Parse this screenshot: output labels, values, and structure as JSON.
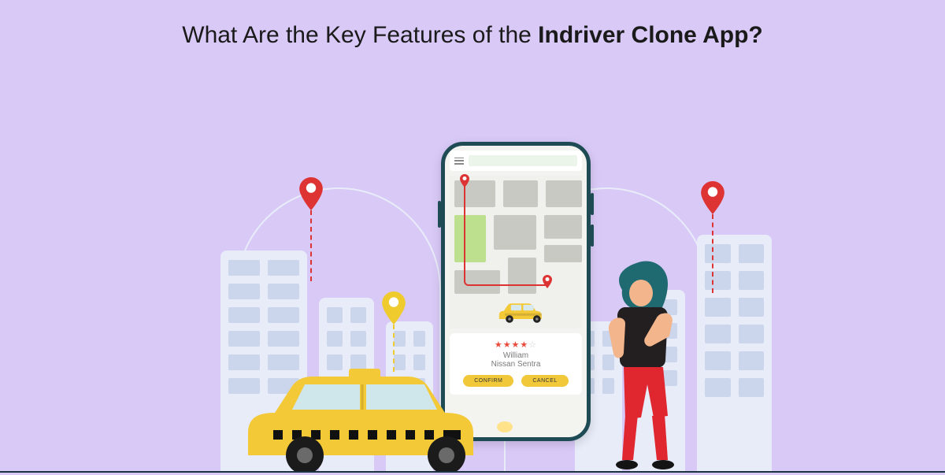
{
  "title_prefix": "What Are the Key Features of the ",
  "title_bold": "Indriver Clone App?",
  "phone": {
    "driver_name": "William",
    "car_model": "Nissan Sentra",
    "confirm_label": "CONFIRM",
    "cancel_label": "CANCEL",
    "rating_filled": 4,
    "rating_total": 5
  },
  "icons": {
    "pin_red": "map-pin-red",
    "pin_yellow": "map-pin-yellow",
    "hamburger": "menu-icon"
  },
  "colors": {
    "bg": "#D9C9F7",
    "building": "#E8ECF8",
    "taxi": "#F3C937",
    "accent_red": "#D33",
    "accent_yellow": "#EFCB2E",
    "phone_frame": "#1F4B55"
  }
}
